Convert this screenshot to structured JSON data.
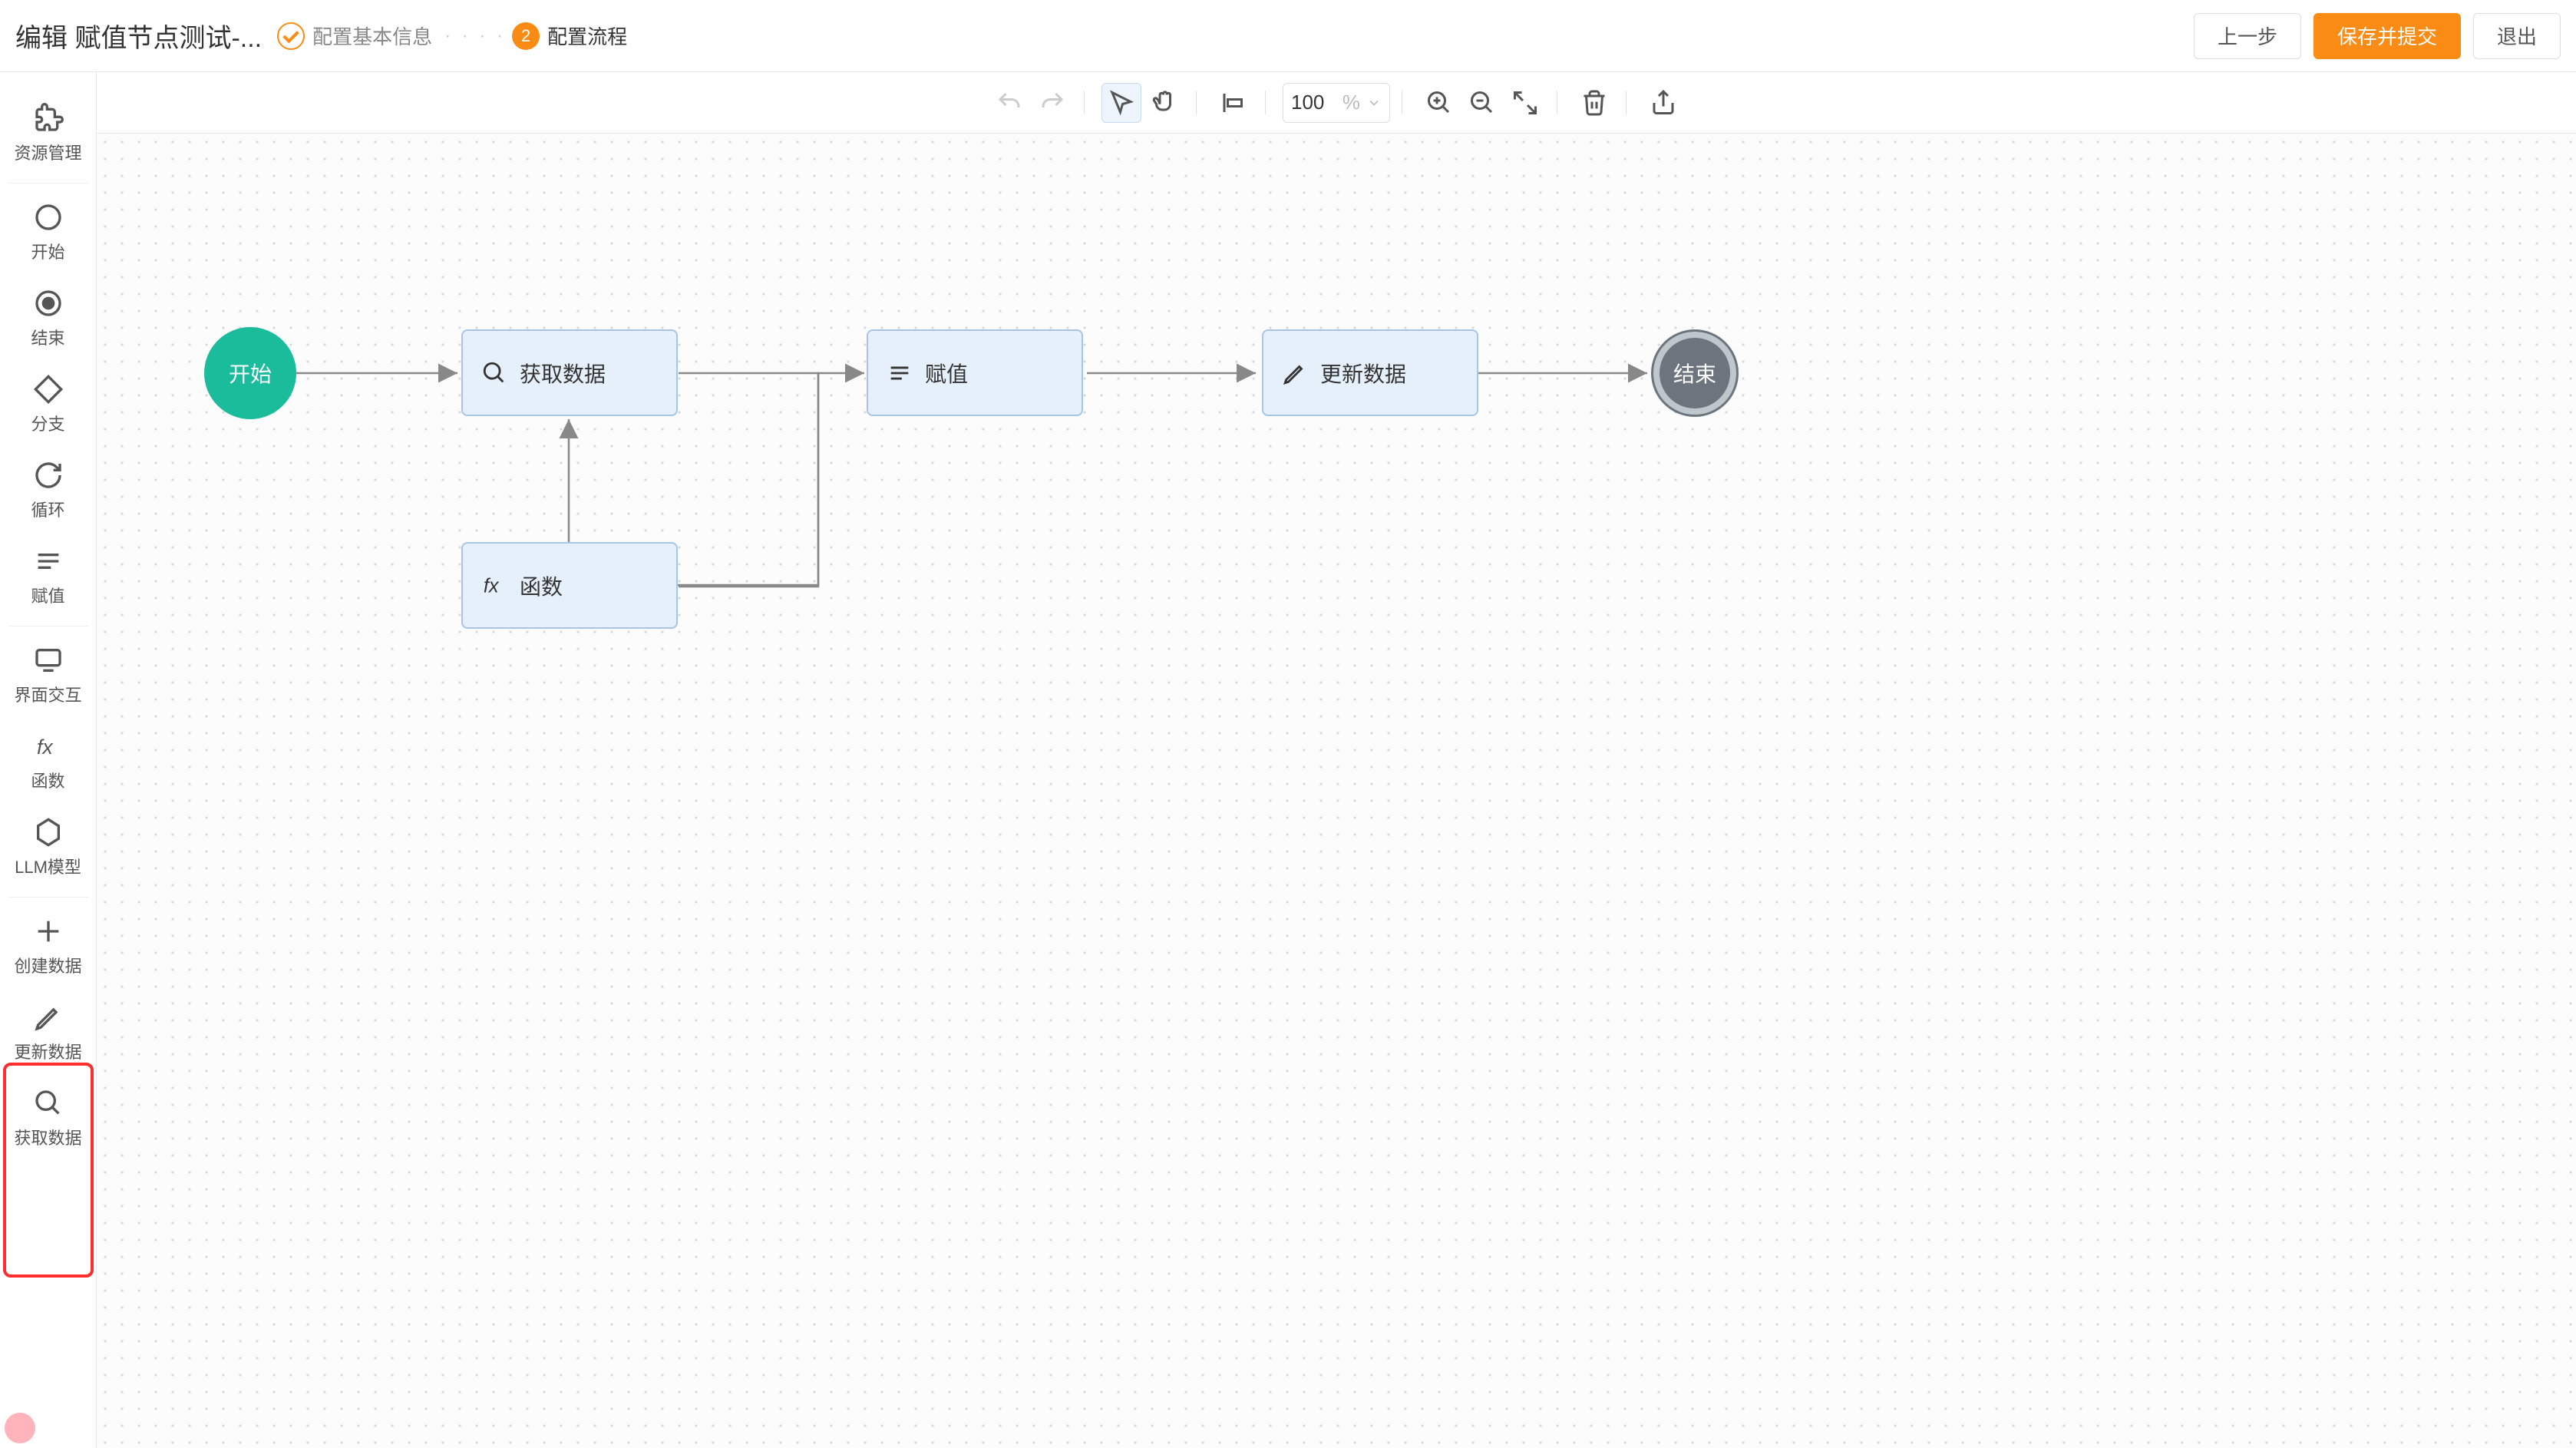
{
  "header": {
    "title": "编辑 赋值节点测试-...",
    "step1_label": "配置基本信息",
    "step2_num": "2",
    "step2_label": "配置流程",
    "prev": "上一步",
    "submit": "保存并提交",
    "exit": "退出"
  },
  "toolbar": {
    "zoom": "100",
    "pct": "%"
  },
  "sidebar": {
    "resources": "资源管理",
    "start": "开始",
    "end": "结束",
    "branch": "分支",
    "loop": "循环",
    "assign": "赋值",
    "ui": "界面交互",
    "func": "函数",
    "llm": "LLM模型",
    "create": "创建数据",
    "update": "更新数据",
    "fetch": "获取数据"
  },
  "nodes": {
    "start": "开始",
    "fetch": "获取数据",
    "assign": "赋值",
    "update": "更新数据",
    "end": "结束",
    "func": "函数"
  }
}
